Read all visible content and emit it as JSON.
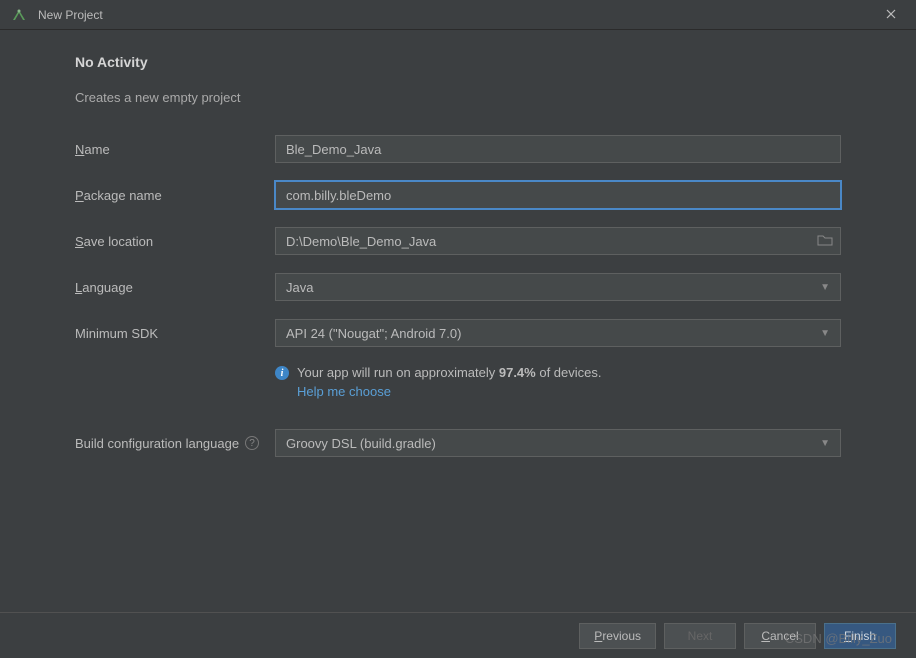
{
  "window": {
    "title": "New Project"
  },
  "header": {
    "title": "No Activity",
    "subtitle": "Creates a new empty project"
  },
  "form": {
    "name": {
      "label_pre": "N",
      "label_rest": "ame",
      "value": "Ble_Demo_Java"
    },
    "package": {
      "label_pre": "P",
      "label_rest": "ackage name",
      "value": "com.billy.bleDemo"
    },
    "saveLocation": {
      "label_pre": "S",
      "label_rest": "ave location",
      "value": "D:\\Demo\\Ble_Demo_Java"
    },
    "language": {
      "label_pre": "L",
      "label_rest": "anguage",
      "value": "Java"
    },
    "minSdk": {
      "label": "Minimum SDK",
      "value": "API 24 (\"Nougat\"; Android 7.0)"
    },
    "info": {
      "pre": "Your app will run on approximately ",
      "percent": "97.4%",
      "post": " of devices."
    },
    "helpLink": "Help me choose",
    "buildConfig": {
      "label": "Build configuration language",
      "value": "Groovy DSL (build.gradle)"
    }
  },
  "buttons": {
    "previous_pre": "P",
    "previous_rest": "revious",
    "next": "Next",
    "cancel_pre": "C",
    "cancel_rest": "ancel",
    "finish_pre": "F",
    "finish_rest": "inish"
  },
  "watermark": "CSDN @Billy_Zuo"
}
